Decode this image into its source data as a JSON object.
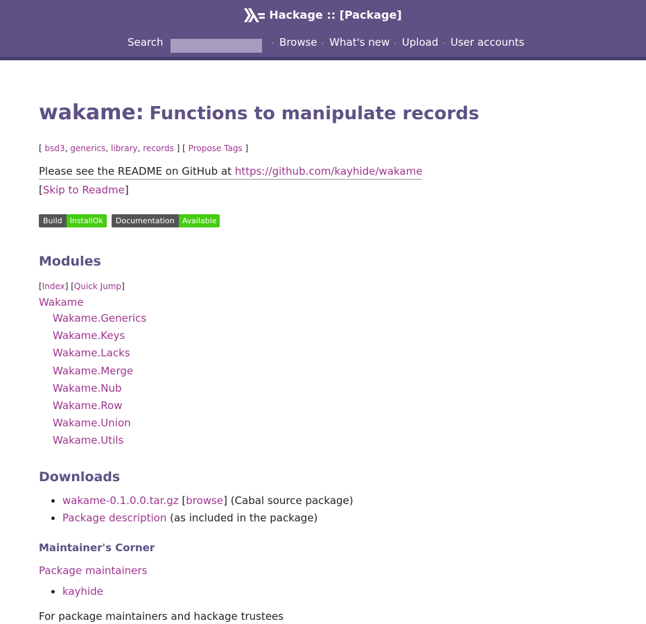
{
  "header": {
    "title": "Hackage :: [Package]",
    "search_label": "Search",
    "nav": [
      "Browse",
      "What's new",
      "Upload",
      "User accounts"
    ]
  },
  "package": {
    "name": "wakame",
    "separator": ":",
    "synopsis": "Functions to manipulate records",
    "tags": [
      "bsd3",
      "generics",
      "library",
      "records"
    ],
    "propose_tags": "Propose Tags",
    "description_prefix": "Please see the README on GitHub at ",
    "description_link": "https://github.com/kayhide/wakame",
    "skip_readme": "Skip to Readme",
    "badges": [
      {
        "label": "Build",
        "value": "InstallOk"
      },
      {
        "label": "Documentation",
        "value": "Available"
      }
    ]
  },
  "modules": {
    "heading": "Modules",
    "index_link": "Index",
    "quick_jump_link": "Quick Jump",
    "root": "Wakame",
    "items": [
      "Wakame.Generics",
      "Wakame.Keys",
      "Wakame.Lacks",
      "Wakame.Merge",
      "Wakame.Nub",
      "Wakame.Row",
      "Wakame.Union",
      "Wakame.Utils"
    ]
  },
  "downloads": {
    "heading": "Downloads",
    "tarball": "wakame-0.1.0.0.tar.gz",
    "browse": "browse",
    "tarball_suffix": "(Cabal source package)",
    "pkg_desc": "Package description",
    "pkg_desc_suffix": "(as included in the package)"
  },
  "maintainer": {
    "heading": "Maintainer's Corner",
    "maintainers_link": "Package maintainers",
    "list": [
      "kayhide"
    ],
    "cutoff_text": "For package maintainers and hackage trustees"
  },
  "colors": {
    "header_bg": "#5e5184",
    "link": "#9e358f",
    "heading": "#5e5184",
    "badge_ok": "#44cc11"
  }
}
